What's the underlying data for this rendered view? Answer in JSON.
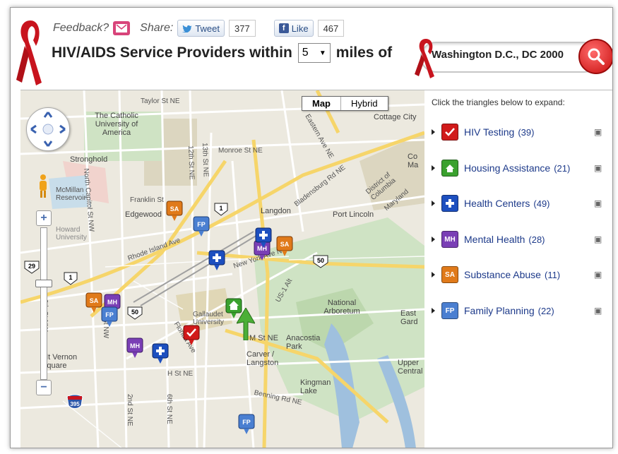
{
  "header": {
    "feedback_label": "Feedback?",
    "share_label": "Share:",
    "tweet_label": "Tweet",
    "tweet_count": "377",
    "like_label": "Like",
    "like_count": "467",
    "title_prefix": "HIV/AIDS Service Providers within",
    "miles_value": "5",
    "title_suffix": "miles of",
    "search_value": "Washington D.C., DC 2000",
    "icons": [
      "red-ribbon-icon",
      "mail-icon",
      "twitter-bird-icon",
      "facebook-icon",
      "search-magnifier-icon"
    ],
    "colors": {
      "ribbon": "#c8141e",
      "search_button": "#d91515",
      "link_blue": "#1d3a8a"
    }
  },
  "map": {
    "type_buttons": [
      "Map",
      "Hybrid"
    ],
    "selected_type": "Map",
    "labels": [
      "Taylor St NE",
      "The Catholic University of America",
      "Cottage City",
      "Monroe St NE",
      "Stronghold",
      "McMillan Reservoir",
      "Franklin St",
      "Edgewood",
      "Langdon",
      "Port Lincoln",
      "Howard University",
      "Rhode Island Ave",
      "New York Ave NE",
      "Bladensburg Rd NE",
      "National Arboretum",
      "Gallaudet University",
      "M St NE",
      "Anacostia Park",
      "Carver / Langston",
      "Kingman Lake",
      "H St NE",
      "Benning Rd NE",
      "Mt Vernon Square",
      "North Capitol St NW",
      "12th St NE",
      "13th St NE",
      "9th St NW",
      "1st St NW",
      "Florida Ave",
      "2nd St NE",
      "6th St NE",
      "Eastern Ave NE",
      "US-1 Alt",
      "Maryland",
      "District of Columbia",
      "Upper Central",
      "East Gard",
      "Co Ma"
    ],
    "markers": [
      "SA",
      "FP",
      "SA",
      "MH",
      "health-center",
      "health-center",
      "SA",
      "MH",
      "FP",
      "housing",
      "hiv-testing",
      "MH",
      "health-center",
      "FP"
    ],
    "routes": [
      "1",
      "1",
      "50",
      "29",
      "50",
      "395"
    ]
  },
  "sidebar": {
    "hint": "Click the triangles below to expand:",
    "categories": [
      {
        "label": "HIV Testing",
        "count": "(39)",
        "icon": "red-check-icon",
        "color": "#d11a1a",
        "abbr": "✓"
      },
      {
        "label": "Housing Assistance",
        "count": "(21)",
        "icon": "green-house-icon",
        "color": "#3aa12e",
        "abbr": "⌂"
      },
      {
        "label": "Health Centers",
        "count": "(49)",
        "icon": "blue-cross-icon",
        "color": "#1d4fbf",
        "abbr": "+"
      },
      {
        "label": "Mental Health",
        "count": "(28)",
        "icon": "purple-mh-icon",
        "color": "#7a3fb5",
        "abbr": "MH"
      },
      {
        "label": "Substance Abuse",
        "count": "(11)",
        "icon": "orange-sa-icon",
        "color": "#e07a1a",
        "abbr": "SA"
      },
      {
        "label": "Family Planning",
        "count": "(22)",
        "icon": "blue-fp-icon",
        "color": "#4a7fd1",
        "abbr": "FP"
      }
    ]
  }
}
